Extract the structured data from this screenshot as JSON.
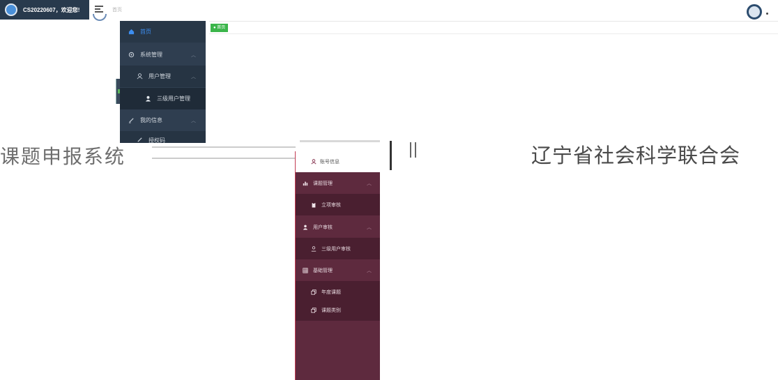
{
  "header": {
    "greeting": "CS20220607，欢迎您!",
    "breadcrumb": "首页",
    "home_tag": "● 首页"
  },
  "admin_sidebar": {
    "items": [
      {
        "label": "首页",
        "icon": "home-icon"
      },
      {
        "label": "系统管理",
        "icon": "gear-icon"
      },
      {
        "label": "用户管理",
        "icon": "user-icon"
      },
      {
        "label": "三级用户管理",
        "icon": "person-icon"
      },
      {
        "label": "我的信息",
        "icon": "pen-icon"
      },
      {
        "label": "授权码",
        "icon": "pen-icon"
      }
    ]
  },
  "banner": {
    "left": "课题申报系统",
    "right": "辽宁省社会科学联合会"
  },
  "review_sidebar": {
    "header": "账号信息",
    "items": [
      {
        "label": "课题管理",
        "icon": "bar-chart-icon"
      },
      {
        "label": "立项审核",
        "icon": "clipboard-icon"
      },
      {
        "label": "用户审核",
        "icon": "person-icon"
      },
      {
        "label": "三级用户审核",
        "icon": "user-icon"
      },
      {
        "label": "基础管理",
        "icon": "grid-icon"
      },
      {
        "label": "年度课题",
        "icon": "copy-icon"
      },
      {
        "label": "课题类别",
        "icon": "copy-icon"
      }
    ]
  },
  "colors": {
    "admin_sidebar": "#2f3e50",
    "review_sidebar": "#5e2a3e",
    "accent_blue": "#3d8ef0",
    "tag_green": "#3bb54a"
  }
}
